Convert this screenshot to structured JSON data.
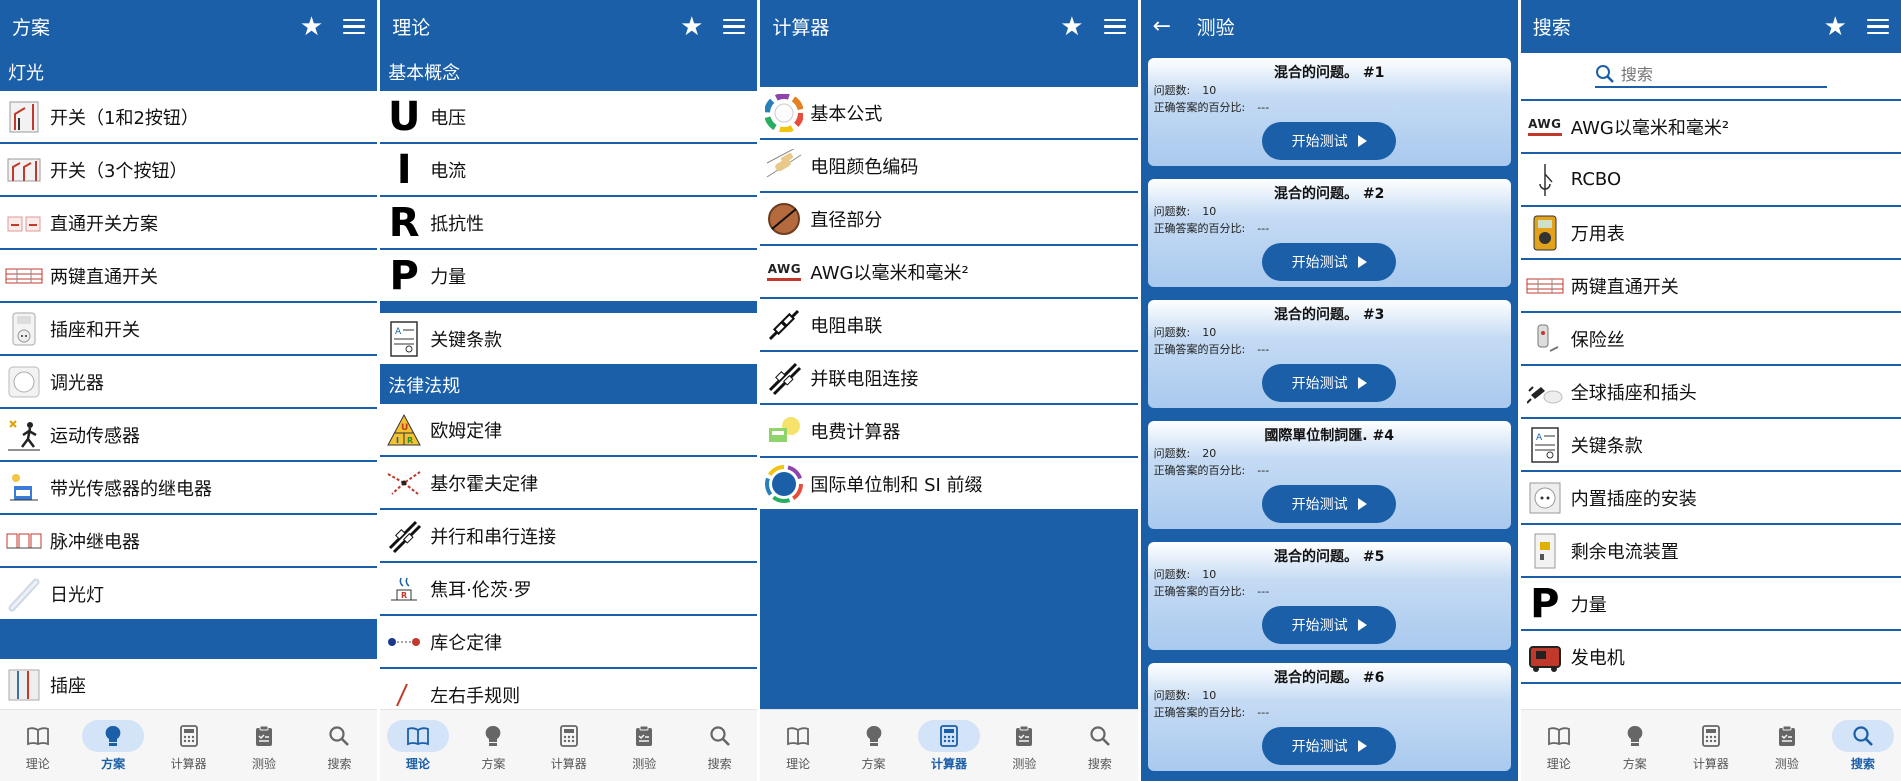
{
  "colors": {
    "primary": "#1a5fa8",
    "nav_active_bg": "#d3e3f8"
  },
  "nav": [
    {
      "key": "theory",
      "label": "理论",
      "icon": "book-icon"
    },
    {
      "key": "scheme",
      "label": "方案",
      "icon": "lightbulb-icon"
    },
    {
      "key": "calc",
      "label": "计算器",
      "icon": "calculator-icon"
    },
    {
      "key": "quiz",
      "label": "测验",
      "icon": "clipboard-icon"
    },
    {
      "key": "search",
      "label": "搜索",
      "icon": "search-icon"
    }
  ],
  "screen1": {
    "title": "方案",
    "section": "灯光",
    "items": [
      "开关（1和2按钮）",
      "开关（3个按钮）",
      "直通开关方案",
      "两键直通开关",
      "插座和开关",
      "调光器",
      "运动传感器",
      "带光传感器的继电器",
      "脉冲继电器",
      "日光灯"
    ],
    "after_band_item": "插座"
  },
  "screen2": {
    "title": "理论",
    "section1": "基本概念",
    "letters": [
      {
        "letter": "U",
        "label": "电压"
      },
      {
        "letter": "I",
        "label": "电流"
      },
      {
        "letter": "R",
        "label": "抵抗性"
      },
      {
        "letter": "P",
        "label": "力量"
      }
    ],
    "key_terms": "关键条款",
    "section2": "法律法规",
    "laws": [
      "欧姆定律",
      "基尔霍夫定律",
      "并行和串行连接",
      "焦耳·伦茨·罗",
      "库仑定律",
      "左右手规则"
    ],
    "ohm_letters": [
      "U",
      "I",
      "R"
    ]
  },
  "screen3": {
    "title": "计算器",
    "items": [
      "基本公式",
      "电阻颜色编码",
      "直径部分",
      "AWG以毫米和毫米²",
      "电阻串联",
      "并联电阻连接",
      "电费计算器",
      "国际单位制和 SI 前缀"
    ],
    "awg_text": "AWG",
    "si_text": "SI"
  },
  "screen4": {
    "title": "测验",
    "count_label": "问题数:",
    "percent_label": "正确答案的百分比:",
    "start_label": "开始测试",
    "cards": [
      {
        "title": "混合的问题。 #1",
        "count": "10",
        "percent": "---"
      },
      {
        "title": "混合的问题。 #2",
        "count": "10",
        "percent": "---"
      },
      {
        "title": "混合的问题。 #3",
        "count": "10",
        "percent": "---"
      },
      {
        "title": "國際單位制詞匯. #4",
        "count": "20",
        "percent": "---"
      },
      {
        "title": "混合的问题。 #5",
        "count": "10",
        "percent": "---"
      },
      {
        "title": "混合的问题。 #6",
        "count": "10",
        "percent": "---"
      }
    ]
  },
  "screen5": {
    "title": "搜索",
    "search_placeholder": "搜索",
    "items": [
      "AWG以毫米和毫米²",
      "RCBO",
      "万用表",
      "两键直通开关",
      "保险丝",
      "全球插座和插头",
      "关键条款",
      "内置插座的安装",
      "剩余电流装置",
      "力量",
      "发电机"
    ],
    "awg_text": "AWG",
    "p_letter": "P"
  }
}
